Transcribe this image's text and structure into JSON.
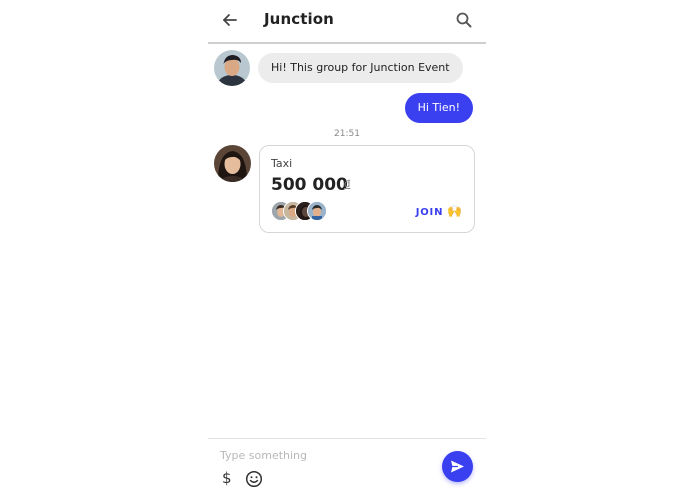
{
  "header": {
    "title": "Junction",
    "back_icon": "arrow-left-icon",
    "search_icon": "search-icon"
  },
  "messages": [
    {
      "direction": "incoming",
      "text": "Hi! This group for Junction Event"
    },
    {
      "direction": "outgoing",
      "text": "Hi Tien!"
    }
  ],
  "timestamp": "21:51",
  "payment_card": {
    "label": "Taxi",
    "amount": "500 000",
    "currency": "đ",
    "participants_count": 4,
    "join_label": "JOIN",
    "join_emoji": "🙌"
  },
  "composer": {
    "placeholder": "Type something",
    "value": "",
    "money_icon": "$",
    "emoji_icon": "smiley-icon",
    "send_icon": "send-icon"
  },
  "colors": {
    "accent": "#3a3ff0",
    "incoming_bubble": "#ececec",
    "text": "#222222"
  }
}
